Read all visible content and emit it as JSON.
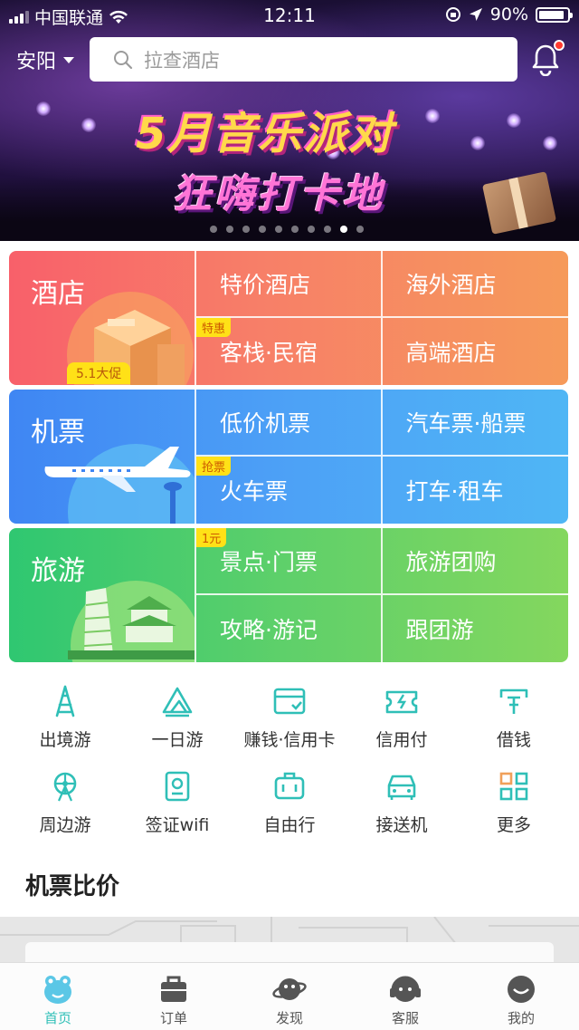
{
  "status_bar": {
    "carrier": "中国联通",
    "time": "12:11",
    "battery": "90%"
  },
  "header": {
    "city": "安阳",
    "search_placeholder": "拉查酒店"
  },
  "banner": {
    "title_line1": "5月音乐派对",
    "title_line2": "狂嗨打卡地",
    "page_count": 10,
    "active_page": 9
  },
  "grid": {
    "hotel": {
      "title": "酒店",
      "promo": "5.1大促",
      "cells": [
        "特价酒店",
        "海外酒店",
        "客栈·民宿",
        "高端酒店"
      ],
      "tag": "特惠"
    },
    "flight": {
      "title": "机票",
      "cells": [
        "低价机票",
        "汽车票·船票",
        "火车票",
        "打车·租车"
      ],
      "tag": "抢票"
    },
    "travel": {
      "title": "旅游",
      "cells": [
        "景点·门票",
        "旅游团购",
        "攻略·游记",
        "跟团游"
      ],
      "tag": "1元"
    }
  },
  "quick": [
    {
      "label": "出境游",
      "icon": "tower-icon"
    },
    {
      "label": "一日游",
      "icon": "mountain-icon"
    },
    {
      "label": "赚钱·信用卡",
      "icon": "card-icon"
    },
    {
      "label": "信用付",
      "icon": "ticket-icon"
    },
    {
      "label": "借钱",
      "icon": "money-icon"
    },
    {
      "label": "周边游",
      "icon": "ferris-wheel-icon"
    },
    {
      "label": "签证wifi",
      "icon": "passport-icon"
    },
    {
      "label": "自由行",
      "icon": "luggage-icon"
    },
    {
      "label": "接送机",
      "icon": "car-icon"
    },
    {
      "label": "更多",
      "icon": "grid-icon"
    }
  ],
  "section": {
    "title": "机票比价"
  },
  "tabs": [
    {
      "label": "首页",
      "icon": "home-icon",
      "active": true
    },
    {
      "label": "订单",
      "icon": "briefcase-icon",
      "active": false
    },
    {
      "label": "发现",
      "icon": "planet-icon",
      "active": false
    },
    {
      "label": "客服",
      "icon": "headset-icon",
      "active": false
    },
    {
      "label": "我的",
      "icon": "profile-icon",
      "active": false
    }
  ],
  "colors": {
    "accent": "#2fbfb7",
    "hotel": "#f8606a",
    "flight": "#3f86f3",
    "travel": "#2fc771",
    "tag": "#ffe117"
  }
}
